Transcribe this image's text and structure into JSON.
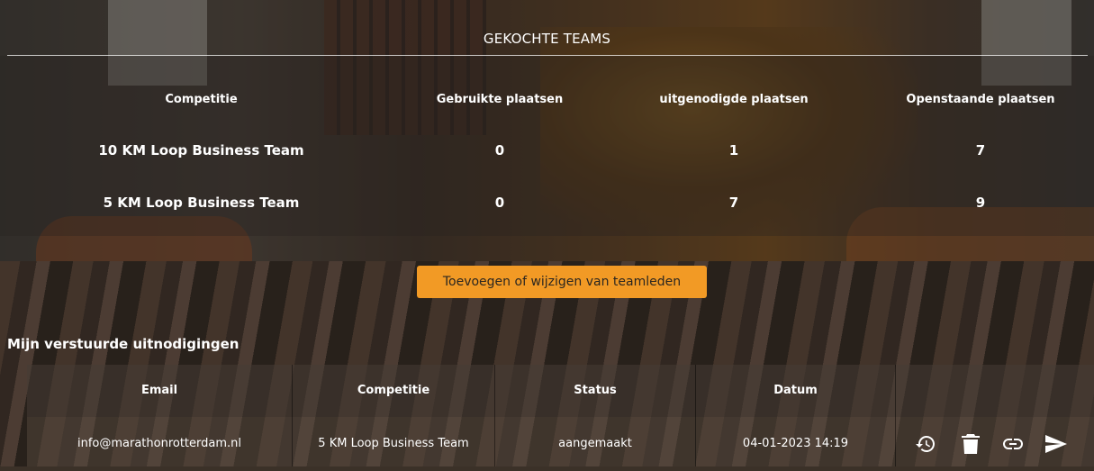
{
  "teams": {
    "title": "GEKOCHTE TEAMS",
    "headers": [
      "Competitie",
      "Gebruikte plaatsen",
      "uitgenodigde plaatsen",
      "Openstaande plaatsen"
    ],
    "rows": [
      [
        "10 KM Loop Business Team",
        "0",
        "1",
        "7"
      ],
      [
        "5 KM Loop Business Team",
        "0",
        "7",
        "9"
      ]
    ]
  },
  "edit_button_label": "Toevoegen of wijzigen van teamleden",
  "invites": {
    "title": "Mijn verstuurde uitnodigingen",
    "headers": [
      "Email",
      "Competitie",
      "Status",
      "Datum",
      ""
    ],
    "rows": [
      {
        "email": "info@marathonrotterdam.nl",
        "competition": "5 KM Loop Business Team",
        "status": "aangemaakt",
        "date": "04-01-2023 14:19",
        "actions": [
          "history-icon",
          "trash-icon",
          "link-icon",
          "send-icon"
        ]
      }
    ]
  },
  "colors": {
    "accent": "#f29a25",
    "text": "#ffffff"
  }
}
